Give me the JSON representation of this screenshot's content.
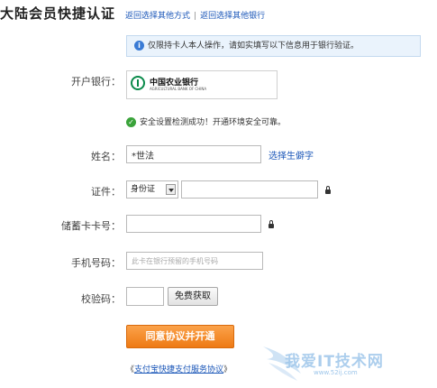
{
  "header": {
    "title": "大陆会员快捷认证",
    "link_other_method": "返回选择其他方式",
    "separator": "|",
    "link_other_bank": "返回选择其他银行"
  },
  "notice": {
    "text": "仅限持卡人本人操作，请如实填写以下信息用于银行验证。",
    "icon": "info-icon"
  },
  "bank": {
    "label": "开户银行：",
    "name": "中国农业银行",
    "name_en": "AGRICULTURAL BANK OF CHINA"
  },
  "security": {
    "text": "安全设置检测成功！开通环境安全可靠。",
    "icon": "check-icon"
  },
  "form": {
    "name_label": "姓名：",
    "name_value": "*世法",
    "rare_char_link": "选择生僻字",
    "id_label": "证件：",
    "id_type": "身份证",
    "id_value": "",
    "card_label": "储蓄卡卡号：",
    "card_value": "",
    "phone_label": "手机号码：",
    "phone_placeholder": "此卡在银行预留的手机号码",
    "code_label": "校验码：",
    "code_value": "",
    "sms_button": "免费获取"
  },
  "submit_label": "同意协议并开通",
  "agreement": {
    "prefix": "《",
    "link": "支付宝快捷支付服务协议",
    "suffix": "》"
  },
  "watermark": {
    "text": "我爱IT技术网",
    "url": "www.52ij.com"
  },
  "colors": {
    "link": "#1a56b8",
    "submit": "#f08a1f",
    "notice_bg": "#eaf3fc",
    "success": "#3aa33a"
  }
}
